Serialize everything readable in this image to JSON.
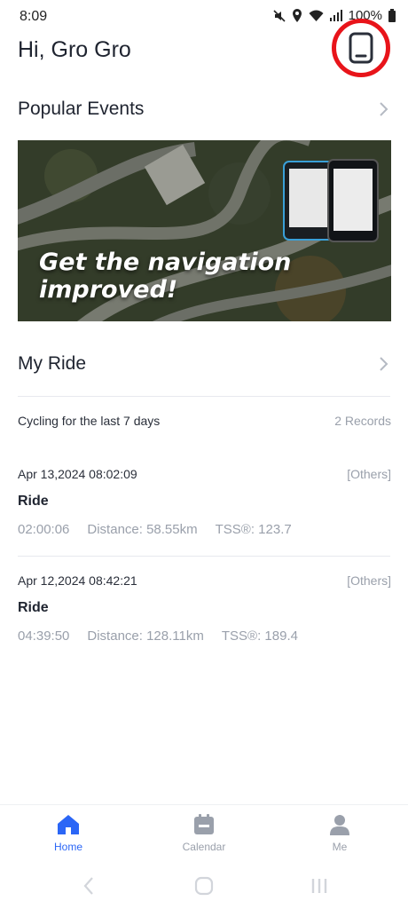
{
  "status_bar": {
    "time": "8:09",
    "battery": "100%"
  },
  "header": {
    "greeting": "Hi, Gro Gro"
  },
  "popular_events": {
    "title": "Popular Events",
    "banner_text_line1": "Get the navigation",
    "banner_text_line2": "improved!"
  },
  "my_ride": {
    "title": "My Ride",
    "summary_label": "Cycling for the last 7 days",
    "summary_count": "2 Records",
    "rides": [
      {
        "datetime": "Apr 13,2024 08:02:09",
        "tag": "[Others]",
        "name": "Ride",
        "duration": "02:00:06",
        "distance": "Distance:  58.55km",
        "tss": "TSS®: 123.7"
      },
      {
        "datetime": "Apr 12,2024 08:42:21",
        "tag": "[Others]",
        "name": "Ride",
        "duration": "04:39:50",
        "distance": "Distance:  128.11km",
        "tss": "TSS®: 189.4"
      }
    ]
  },
  "bottom_nav": {
    "home": "Home",
    "calendar": "Calendar",
    "me": "Me"
  },
  "colors": {
    "accent": "#2b66f6",
    "highlight_ring": "#e8141a",
    "muted": "#9aa0ab"
  }
}
